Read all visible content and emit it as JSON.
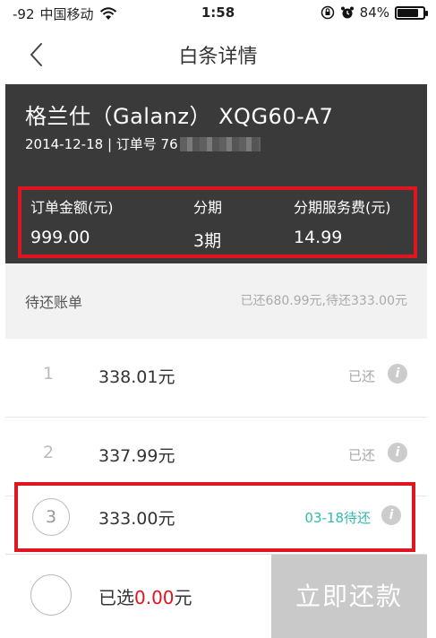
{
  "status_bar": {
    "signal": "-92",
    "carrier": "中国移动",
    "wifi_icon": "wifi-icon",
    "time": "1:58",
    "battery": "84%",
    "battery_level": 0.84
  },
  "nav": {
    "back_icon": "chevron-left-icon",
    "title": "白条详情"
  },
  "product": {
    "name": "格兰仕（Galanz） XQG60-A7",
    "date_order": "2014-12-18 | 订单号 76"
  },
  "summary": {
    "amount_label": "订单金额(元)",
    "amount_value": "999.00",
    "period_label": "分期",
    "period_value": "3期",
    "fee_label": "分期服务费(元)",
    "fee_value": "14.99"
  },
  "bills": {
    "label": "待还账单",
    "summary": "已还680.99元,待还333.00元",
    "rows": [
      {
        "index": "1",
        "amount": "338.01元",
        "status": "已还"
      },
      {
        "index": "2",
        "amount": "337.99元",
        "status": "已还"
      },
      {
        "index": "3",
        "amount": "333.00元",
        "status": "03-18待还"
      }
    ]
  },
  "footer": {
    "selected_prefix": "已选",
    "selected_amount": "0.00",
    "selected_unit": "元",
    "pay_label": "立即还款"
  },
  "colors": {
    "highlight": "#e0151f",
    "due_status": "#33b8b0"
  }
}
